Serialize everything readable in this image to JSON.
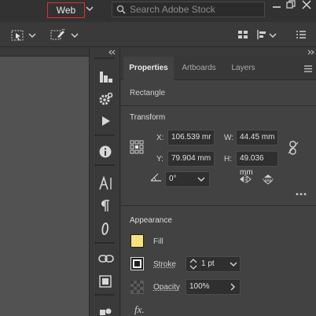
{
  "topbar": {
    "workspace_label": "Web",
    "search_placeholder": "Search Adobe Stock"
  },
  "panel": {
    "tabs": [
      {
        "label": "Properties",
        "active": true
      },
      {
        "label": "Artboards",
        "active": false
      },
      {
        "label": "Layers",
        "active": false
      }
    ],
    "selection_label": "Rectangle",
    "transform": {
      "title": "Transform",
      "x_label": "X:",
      "x_value": "106.539 mr",
      "y_label": "Y:",
      "y_value": "79.904 mm",
      "w_label": "W:",
      "w_value": "44.45 mm",
      "h_label": "H:",
      "h_value": "49.036 mm",
      "rotate_value": "0°"
    },
    "appearance": {
      "title": "Appearance",
      "fill_label": "Fill",
      "fill_color": "#f5e27a",
      "stroke_label": "Stroke",
      "stroke_weight": "1 pt",
      "opacity_label": "Opacity",
      "opacity_value": "100%",
      "fx_label": "fx."
    }
  },
  "colors": {
    "accent_outline": "#dd3333",
    "panel_bg": "#424242",
    "canvas_bg": "#525252"
  }
}
